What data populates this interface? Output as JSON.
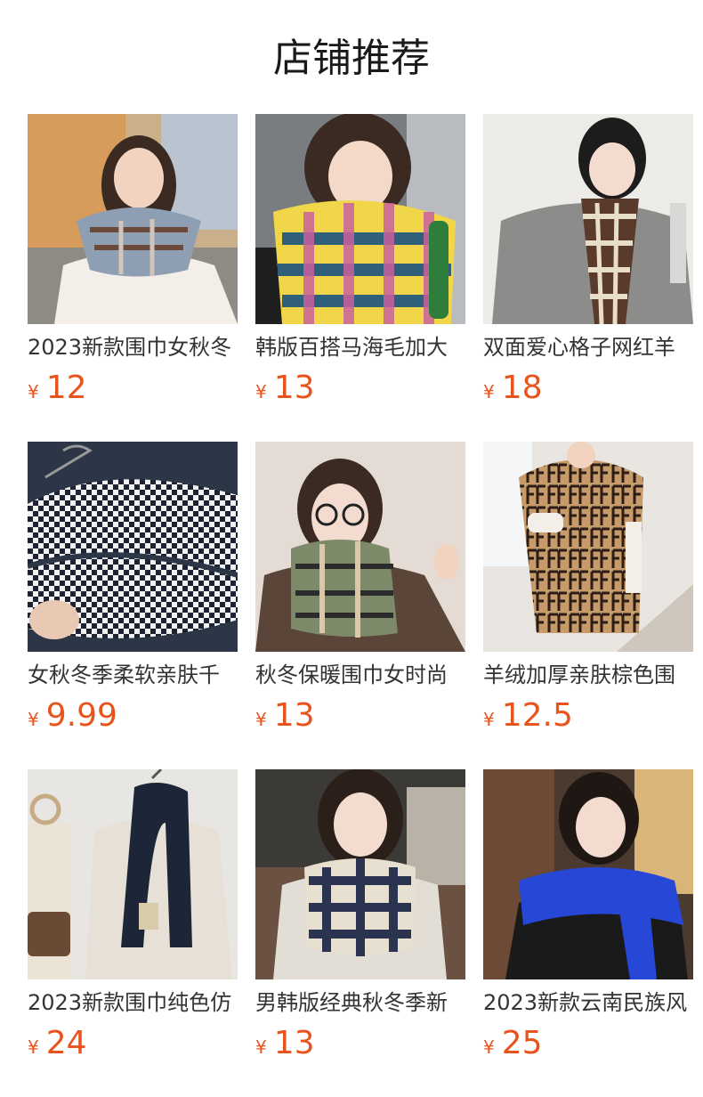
{
  "header": {
    "title": "店铺推荐"
  },
  "currency_symbol": "¥",
  "price_color": "#e8541c",
  "products": [
    {
      "name": "2023新款围巾女秋冬",
      "price": "12",
      "image": "woman-in-white-coat-with-plaid-scarf"
    },
    {
      "name": "韩版百搭马海毛加大",
      "price": "13",
      "image": "girl-with-colorful-check-scarf"
    },
    {
      "name": "双面爱心格子网红羊",
      "price": "18",
      "image": "girl-with-heart-plaid-scarf"
    },
    {
      "name": "女秋冬季柔软亲肤千",
      "price": "9.99",
      "image": "houndstooth-scarf-on-hanger"
    },
    {
      "name": "秋冬保暖围巾女时尚",
      "price": "13",
      "image": "woman-with-glasses-plaid-scarf"
    },
    {
      "name": "羊绒加厚亲肤棕色围",
      "price": "12.5",
      "image": "brown-logo-pattern-shawl"
    },
    {
      "name": "2023新款围巾纯色仿",
      "price": "24",
      "image": "navy-scarf-on-coat"
    },
    {
      "name": "男韩版经典秋冬季新",
      "price": "13",
      "image": "woman-with-navy-check-scarf"
    },
    {
      "name": "2023新款云南民族风",
      "price": "25",
      "image": "woman-with-blue-knit-shawl"
    }
  ]
}
